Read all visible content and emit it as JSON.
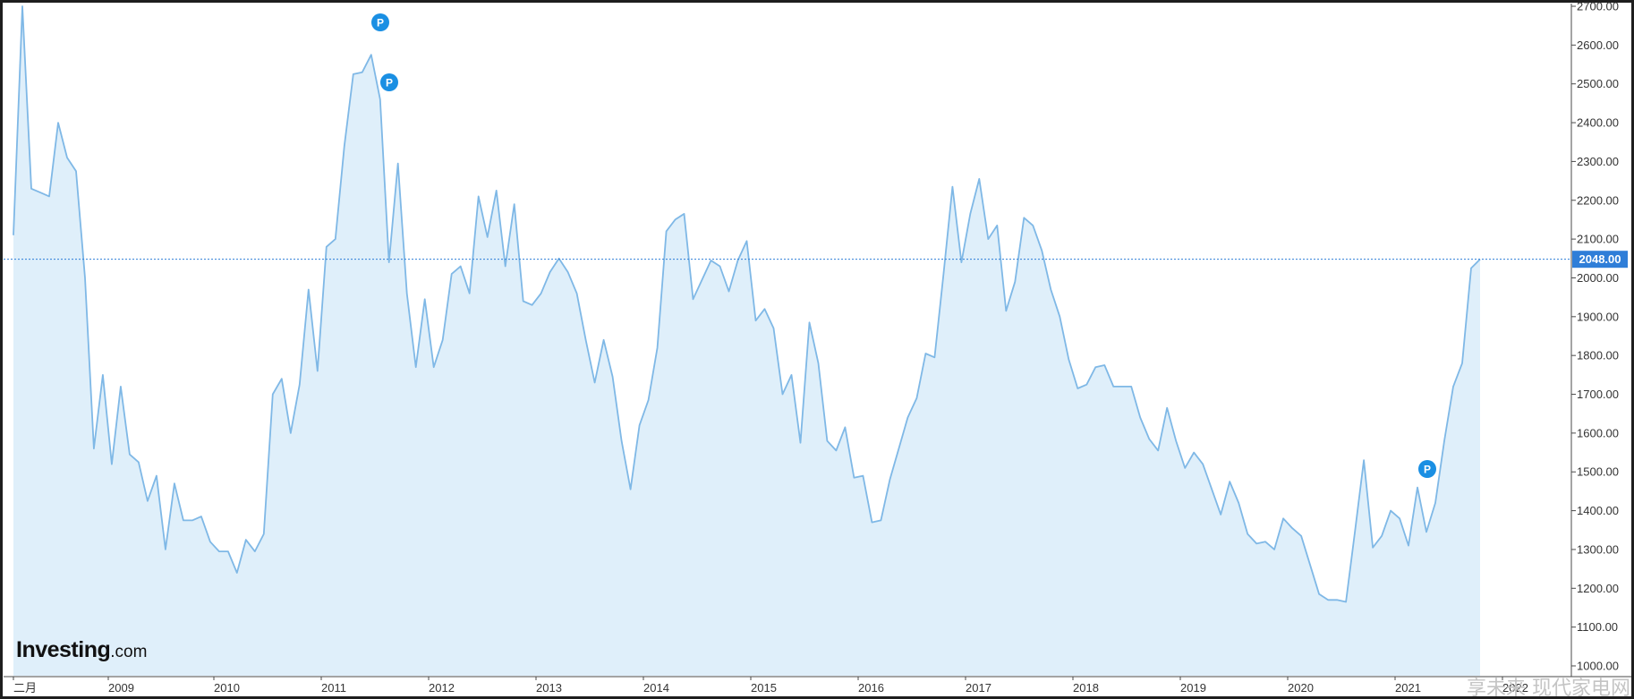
{
  "logo": {
    "brand": "Investing",
    "suffix": ".com"
  },
  "watermark": "享未来 现代家电网",
  "colors": {
    "line": "#7fb8e6",
    "fill": "#dfeffa",
    "accent": "#2f7ed8",
    "current": "#2f7ed8",
    "marker": "#1a8fe3"
  },
  "chart_data": {
    "type": "area",
    "title": "",
    "xlabel": "",
    "ylabel": "",
    "ylim": [
      990,
      2700
    ],
    "y_ticks": [
      "2700.00",
      "2600.00",
      "2500.00",
      "2400.00",
      "2300.00",
      "2200.00",
      "2100.00",
      "2000.00",
      "1900.00",
      "1800.00",
      "1700.00",
      "1600.00",
      "1500.00",
      "1400.00",
      "1300.00",
      "1200.00",
      "1100.00",
      "1000.00"
    ],
    "x_ticks": [
      "二月",
      "2009",
      "2010",
      "2011",
      "2012",
      "2013",
      "2014",
      "2015",
      "2016",
      "2017",
      "2018",
      "2019",
      "2020",
      "2021",
      "2022"
    ],
    "current_value": "2048.00",
    "grid": false,
    "legend": "none",
    "markers": [
      "P",
      "P",
      "P"
    ],
    "series": [
      {
        "values": [
          2110,
          2700,
          2230,
          2220,
          2210,
          2400,
          2310,
          2275,
          2000,
          1560,
          1750,
          1520,
          1720,
          1545,
          1525,
          1425,
          1490,
          1300,
          1470,
          1375,
          1375,
          1385,
          1320,
          1295,
          1295,
          1240,
          1325,
          1295,
          1340,
          1700,
          1740,
          1600,
          1725,
          1970,
          1760,
          2080,
          2100,
          2340,
          2525,
          2530,
          2575,
          2460,
          2040,
          2295,
          1960,
          1770,
          1945,
          1770,
          1840,
          2010,
          2030,
          1960,
          2210,
          2105,
          2225,
          2030,
          2190,
          1940,
          1930,
          1960,
          2015,
          2050,
          2015,
          1960,
          1840,
          1730,
          1840,
          1745,
          1580,
          1455,
          1620,
          1685,
          1820,
          2120,
          2150,
          2165,
          1945,
          1995,
          2045,
          2030,
          1965,
          2045,
          2095,
          1890,
          1920,
          1870,
          1700,
          1750,
          1575,
          1885,
          1780,
          1580,
          1555,
          1615,
          1485,
          1490,
          1370,
          1375,
          1480,
          1560,
          1640,
          1690,
          1805,
          1795,
          2010,
          2235,
          2040,
          2165,
          2255,
          2100,
          2135,
          1915,
          1990,
          2155,
          2135,
          2070,
          1970,
          1900,
          1790,
          1715,
          1725,
          1770,
          1775,
          1720,
          1720,
          1720,
          1640,
          1585,
          1555,
          1665,
          1580,
          1510,
          1550,
          1520,
          1455,
          1390,
          1475,
          1420,
          1340,
          1315,
          1320,
          1300,
          1380,
          1355,
          1335,
          1260,
          1185,
          1170,
          1170,
          1165,
          1345,
          1530,
          1305,
          1335,
          1400,
          1380,
          1310,
          1460,
          1345,
          1420,
          1580,
          1720,
          1780,
          2025,
          2048
        ]
      }
    ]
  }
}
